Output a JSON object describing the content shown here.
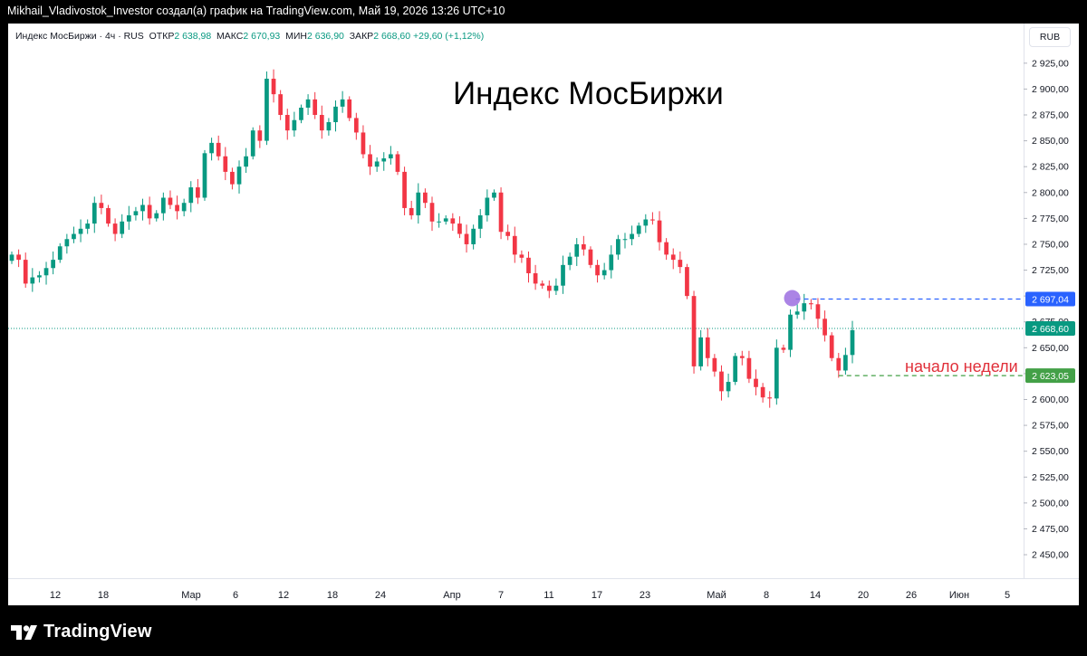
{
  "header": {
    "attribution": "Mikhail_Vladivostok_Investor создал(а) график на TradingView.com, Май 19, 2026 13:26 UTC+10"
  },
  "legend": {
    "symbol": "Индекс МосБиржи · 4ч · RUS",
    "open_label": "ОТКР",
    "open_value": "2 638,98",
    "high_label": "МАКС",
    "high_value": "2 670,93",
    "low_label": "МИН",
    "low_value": "2 636,90",
    "close_label": "ЗАКР",
    "close_value": "2 668,60",
    "change": "+29,60 (+1,12%)"
  },
  "currency": "RUB",
  "title": "Индекс МосБиржи",
  "annotation": "начало недели",
  "footer": {
    "brand": "TradingView"
  },
  "colors": {
    "up": "#089981",
    "down": "#f23645",
    "resistance": "#2962ff",
    "support": "#43a047",
    "marker": "#9c6fe0"
  },
  "chart_data": {
    "type": "candlestick",
    "title": "Индекс МосБиржи",
    "y_ticks": [
      2450,
      2475,
      2500,
      2525,
      2550,
      2575,
      2600,
      2625,
      2650,
      2675,
      2700,
      2725,
      2750,
      2775,
      2800,
      2825,
      2850,
      2875,
      2900,
      2925
    ],
    "y_tick_labels": [
      "2 450,00",
      "2 475,00",
      "2 500,00",
      "2 525,00",
      "2 550,00",
      "2 575,00",
      "2 600,00",
      "2 625,00",
      "2 650,00",
      "2 675,00",
      "2 700,00",
      "2 725,00",
      "2 750,00",
      "2 775,00",
      "2 800,00",
      "2 825,00",
      "2 850,00",
      "2 875,00",
      "2 900,00",
      "2 925,00"
    ],
    "x_tick_labels": [
      "12",
      "18",
      "Мар",
      "6",
      "12",
      "18",
      "24",
      "Апр",
      "7",
      "11",
      "17",
      "23",
      "Май",
      "8",
      "14",
      "20",
      "26",
      "Июн",
      "5"
    ],
    "last_price": 2668.6,
    "last_price_label": "2 668,60",
    "resistance_level": 2697.04,
    "resistance_label": "2 697,04",
    "support_level": 2623.05,
    "support_label": "2 623,05",
    "closes": [
      2740,
      2735,
      2712,
      2718,
      2720,
      2727,
      2735,
      2748,
      2755,
      2760,
      2765,
      2770,
      2790,
      2785,
      2770,
      2760,
      2772,
      2778,
      2782,
      2788,
      2775,
      2780,
      2795,
      2788,
      2782,
      2790,
      2805,
      2795,
      2838,
      2848,
      2835,
      2820,
      2808,
      2825,
      2835,
      2860,
      2850,
      2910,
      2895,
      2875,
      2860,
      2870,
      2882,
      2890,
      2875,
      2860,
      2868,
      2883,
      2890,
      2872,
      2858,
      2837,
      2825,
      2830,
      2833,
      2837,
      2820,
      2785,
      2778,
      2800,
      2790,
      2772,
      2772,
      2775,
      2770,
      2760,
      2750,
      2765,
      2778,
      2795,
      2800,
      2762,
      2758,
      2740,
      2737,
      2722,
      2712,
      2710,
      2705,
      2710,
      2730,
      2738,
      2750,
      2745,
      2730,
      2720,
      2725,
      2740,
      2755,
      2755,
      2760,
      2768,
      2774,
      2773,
      2752,
      2740,
      2735,
      2728,
      2700,
      2632,
      2660,
      2640,
      2627,
      2608,
      2617,
      2642,
      2640,
      2620,
      2612,
      2602,
      2601,
      2650,
      2648,
      2682,
      2685,
      2693,
      2692,
      2678,
      2662,
      2640,
      2628,
      2643,
      2667
    ]
  }
}
